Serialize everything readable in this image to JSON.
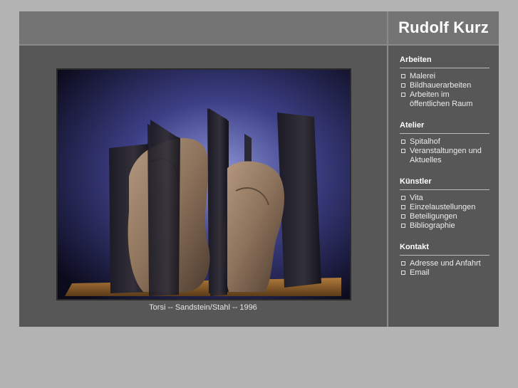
{
  "site": {
    "title": "Rudolf Kurz"
  },
  "photo": {
    "caption": "Torsi -- Sandstein/Stahl -- 1996"
  },
  "nav": {
    "sections": [
      {
        "title": "Arbeiten",
        "items": [
          "Malerei",
          "Bildhauerarbeiten",
          "Arbeiten im öffentlichen Raum"
        ]
      },
      {
        "title": "Atelier",
        "items": [
          "Spitalhof",
          "Veranstaltungen und Aktuelles"
        ]
      },
      {
        "title": "Künstler",
        "items": [
          "Vita",
          "Einzelaustellungen",
          "Beteiligungen",
          "Bibliographie"
        ]
      },
      {
        "title": "Kontakt",
        "items": [
          "Adresse und Anfahrt",
          "Email"
        ]
      }
    ]
  }
}
